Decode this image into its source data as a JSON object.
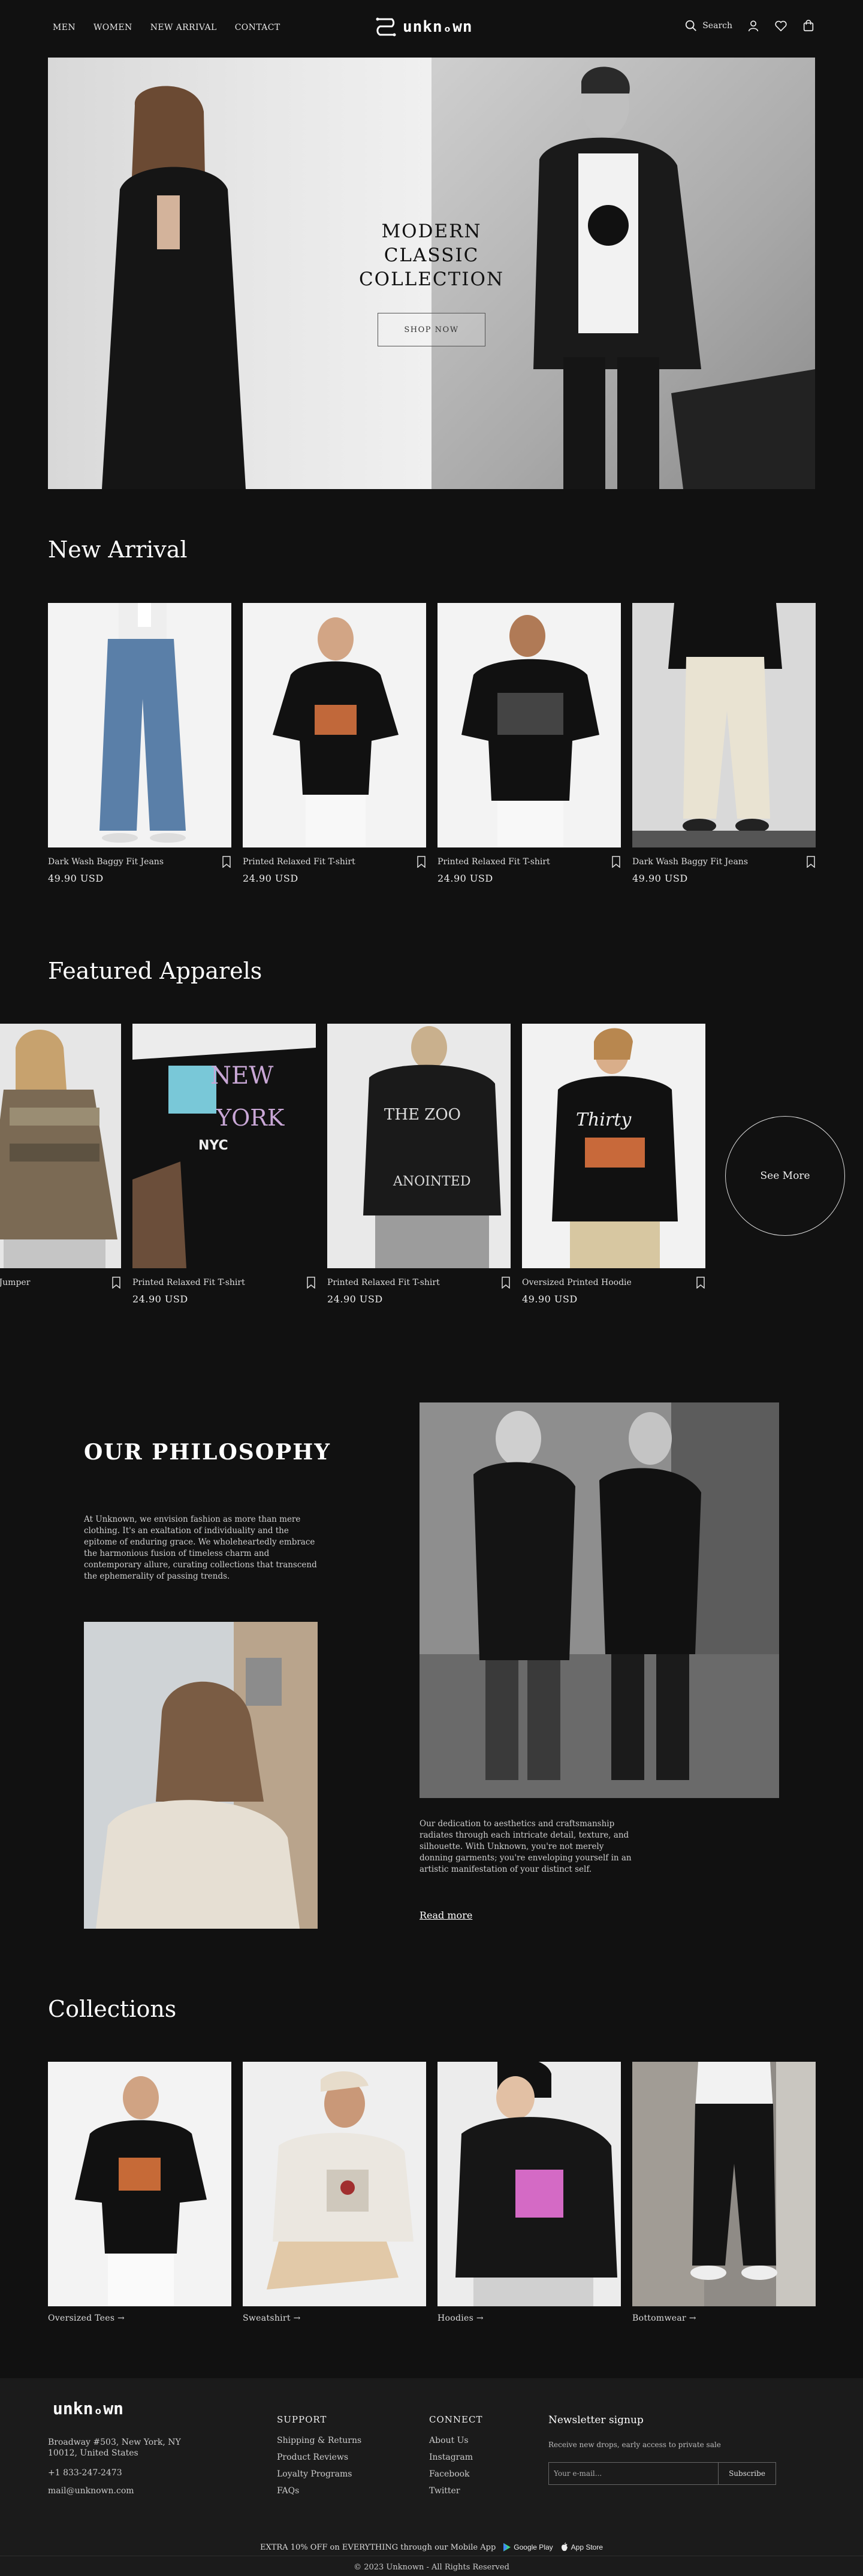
{
  "header": {
    "nav": [
      "MEN",
      "WOMEN",
      "NEW ARRIVAL",
      "CONTACT"
    ],
    "logo": "unknₒwn",
    "search_label": "Search",
    "icons": [
      "search-icon",
      "user-icon",
      "heart-icon",
      "bag-icon"
    ]
  },
  "hero": {
    "title": "MODERN CLASSIC COLLECTION",
    "button": "SHOP NOW"
  },
  "new_arrival": {
    "title": "New Arrival",
    "items": [
      {
        "name": "Dark Wash Baggy Fit Jeans",
        "price": "49.90 USD"
      },
      {
        "name": "Printed Relaxed Fit T-shirt",
        "price": "24.90 USD"
      },
      {
        "name": "Printed Relaxed Fit T-shirt",
        "price": "24.90 USD"
      },
      {
        "name": "Dark Wash Baggy Fit Jeans",
        "price": "49.90 USD"
      }
    ]
  },
  "featured": {
    "title": "Featured Apparels",
    "items": [
      {
        "name": "Jacquard-Knit Jumper",
        "price": ""
      },
      {
        "name": "Printed Relaxed Fit T-shirt",
        "price": "24.90 USD"
      },
      {
        "name": "Printed Relaxed Fit T-shirt",
        "price": "24.90 USD"
      },
      {
        "name": "Oversized Printed Hoodie",
        "price": "49.90 USD"
      }
    ],
    "see_more": "See More"
  },
  "philosophy": {
    "title": "OUR PHILOSOPHY",
    "paragraph1": "At Unknown, we envision fashion as more than mere clothing. It's an exaltation of individuality and the epitome of enduring grace. We wholeheartedly embrace the harmonious fusion of timeless charm and contemporary allure, curating collections that transcend the ephemerality of passing trends.",
    "paragraph2": "Our dedication to aesthetics and craftsmanship radiates through each intricate detail, texture, and silhouette. With Unknown, you're not merely donning garments; you're enveloping yourself in an artistic manifestation of your distinct self.",
    "read_more": "Read more"
  },
  "collections": {
    "title": "Collections",
    "items": [
      "Oversized Tees →",
      "Sweatshirt →",
      "Hoodies →",
      "Bottomwear →"
    ]
  },
  "footer": {
    "logo": "unknₒwn",
    "address1": "Broadway #503, New York, NY",
    "address2": "10012, United States",
    "phone": "+1 833-247-2473",
    "email": "mail@unknown.com",
    "support": {
      "title": "SUPPORT",
      "links": [
        "Shipping & Returns",
        "Product Reviews",
        "Loyalty Programs",
        "FAQs"
      ]
    },
    "connect": {
      "title": "CONNECT",
      "links": [
        "About Us",
        "Instagram",
        "Facebook",
        "Twitter"
      ]
    },
    "newsletter": {
      "title": "Newsletter signup",
      "text": "Receive new drops, early access to private sale",
      "placeholder": "Your e-mail...",
      "button": "Subscribe"
    },
    "promo": "EXTRA 10% OFF on EVERYTHING through our Mobile App",
    "google_play": "Google Play",
    "app_store": "App Store",
    "copyright": "© 2023 Unknown - All Rights Reserved"
  }
}
